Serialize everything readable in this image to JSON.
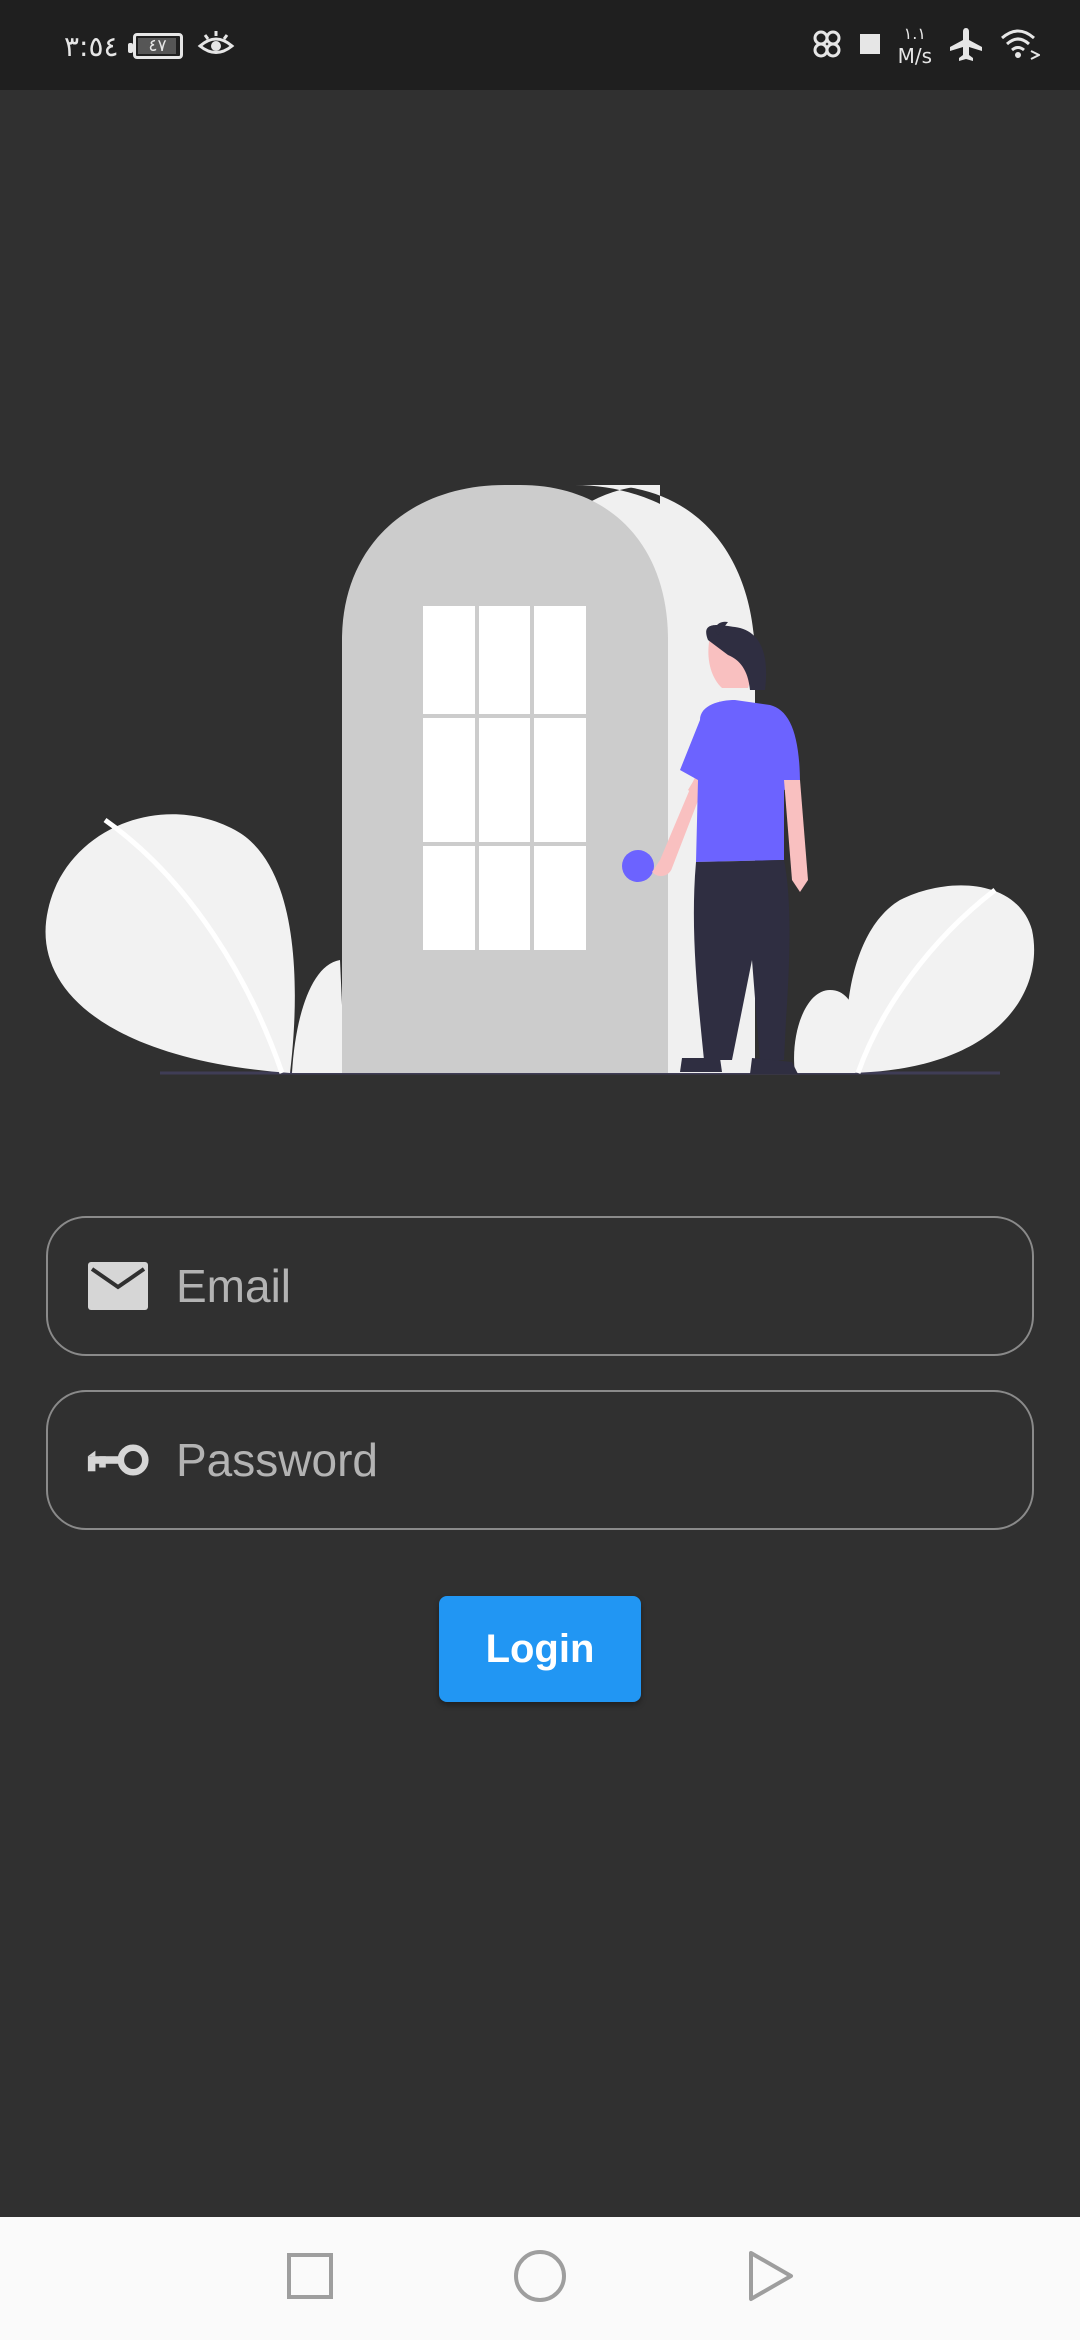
{
  "status_bar": {
    "time": "٣:٥٤",
    "battery": "٤٧",
    "net_speed_value": "١.١",
    "net_speed_unit": "M/s",
    "icons": [
      "eye-icon",
      "data-saver-icon",
      "stop-icon",
      "airplane-icon",
      "wifi-icon"
    ]
  },
  "login_form": {
    "email_placeholder": "Email",
    "password_placeholder": "Password",
    "login_label": "Login"
  },
  "nav_bar": {
    "icons": [
      "recents-square-icon",
      "home-circle-icon",
      "back-triangle-icon"
    ]
  },
  "colors": {
    "background": "#303030",
    "accent": "#2196f3",
    "person_shirt": "#6c63ff"
  }
}
